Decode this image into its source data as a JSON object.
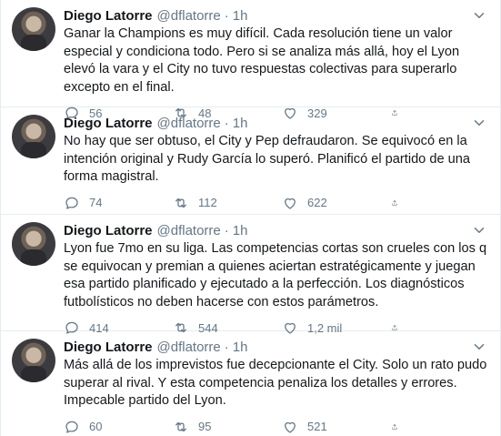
{
  "tweets": [
    {
      "author": "Diego Latorre",
      "handle": "@dflatorre",
      "separator": "·",
      "time": "1h",
      "text": "Ganar la Champions es muy difícil. Cada resolución tiene un valor especial y condiciona todo. Pero si se analiza más allá, hoy el Lyon elevó la vara y el City no tuvo respuestas colectivas para superarlo excepto en el final.",
      "replies": "56",
      "retweets": "48",
      "likes": "329"
    },
    {
      "author": "Diego Latorre",
      "handle": "@dflatorre",
      "separator": "·",
      "time": "1h",
      "text": "No hay que ser obtuso, el City y Pep defraudaron. Se equivocó en la intención original y Rudy García lo superó. Planificó el partido de una forma magistral.",
      "replies": "74",
      "retweets": "112",
      "likes": "622"
    },
    {
      "author": "Diego Latorre",
      "handle": "@dflatorre",
      "separator": "·",
      "time": "1h",
      "text": "Lyon fue 7mo en su liga. Las competencias cortas son crueles con los q se equivocan y premian a quienes aciertan estratégicamente y juegan esa partido planificado y ejecutado a la perfección. Los diagnósticos futbolísticos no deben hacerse con estos parámetros.",
      "replies": "414",
      "retweets": "544",
      "likes": "1,2 mil"
    },
    {
      "author": "Diego Latorre",
      "handle": "@dflatorre",
      "separator": "·",
      "time": "1h",
      "text": "Más allá de los imprevistos fue decepcionante el City. Solo un rato pudo superar al rival. Y esta competencia penaliza los detalles y errores. Impecable partido del Lyon.",
      "replies": "60",
      "retweets": "95",
      "likes": "521"
    }
  ],
  "icons": {
    "menu": "chevron-down-icon",
    "reply": "reply-icon",
    "retweet": "retweet-icon",
    "like": "heart-icon",
    "share": "share-icon"
  },
  "colors": {
    "text": "#14171a",
    "secondary": "#657786",
    "border": "#e6ecf0"
  }
}
